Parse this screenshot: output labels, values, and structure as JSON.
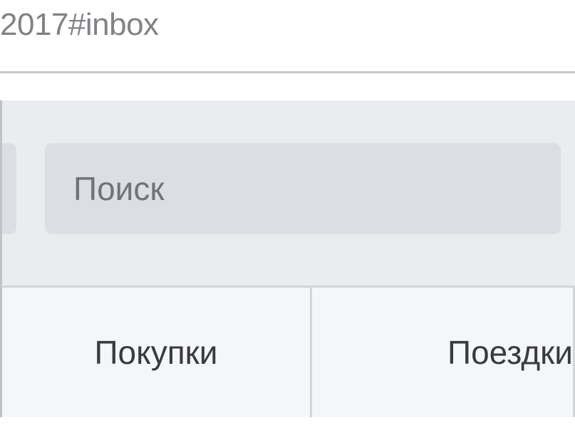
{
  "addressBar": {
    "urlFragment": "2017#inbox"
  },
  "header": {
    "search": {
      "placeholder": "Поиск"
    }
  },
  "tabs": {
    "purchases": "Покупки",
    "trips": "Поездки"
  }
}
